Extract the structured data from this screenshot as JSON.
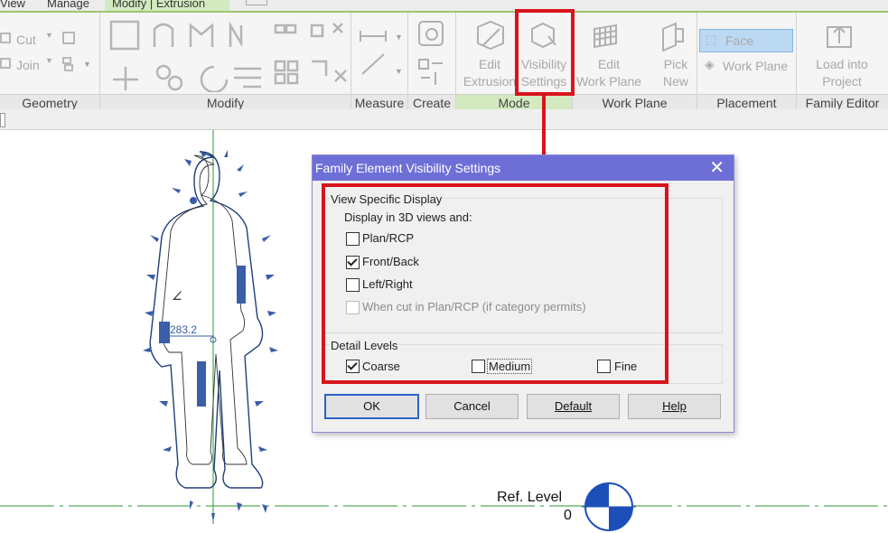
{
  "tabs": {
    "view": "View",
    "manage": "Manage",
    "modify_extrusion": "Modify | Extrusion"
  },
  "geometry_panel": {
    "cut": "Cut",
    "join": "Join",
    "label": "Geometry"
  },
  "modify_panel": {
    "label": "Modify"
  },
  "measure_panel": {
    "label": "Measure"
  },
  "create_panel": {
    "label": "Create"
  },
  "mode_panel": {
    "edit_extrusion": [
      "Edit",
      "Extrusion"
    ],
    "visibility_settings": [
      "Visibility",
      "Settings"
    ],
    "label": "Mode"
  },
  "work_plane_panel": {
    "edit_work_plane": [
      "Edit",
      "Work Plane"
    ],
    "pick_new": [
      "Pick",
      "New"
    ],
    "label": "Work Plane"
  },
  "placement_panel": {
    "face": "Face",
    "work_plane": "Work Plane",
    "label": "Placement"
  },
  "family_editor_panel": {
    "load_into_project": [
      "Load into",
      "Project"
    ],
    "label": "Family Editor"
  },
  "canvas": {
    "dimension": "283.2",
    "ref_level_label": "Ref. Level",
    "ref_level_value": "0"
  },
  "dialog": {
    "title": "Family Element Visibility Settings",
    "view_specific_display": "View Specific Display",
    "display_in_3d": "Display in 3D views and:",
    "options": [
      {
        "label": "Plan/RCP",
        "checked": false,
        "enabled": true
      },
      {
        "label": "Front/Back",
        "checked": true,
        "enabled": true
      },
      {
        "label": "Left/Right",
        "checked": false,
        "enabled": true
      },
      {
        "label": "When cut in Plan/RCP (if category permits)",
        "checked": false,
        "enabled": false
      }
    ],
    "detail_levels": "Detail Levels",
    "levels": [
      {
        "label": "Coarse",
        "checked": true
      },
      {
        "label": "Medium",
        "checked": false
      },
      {
        "label": "Fine",
        "checked": false
      }
    ],
    "buttons": {
      "ok": "OK",
      "cancel": "Cancel",
      "default": "Default",
      "help": "Help"
    }
  },
  "colors": {
    "highlight": "#d9141d",
    "title_bar": "#6e6fd6",
    "ribbon_accent": "#9ec66f",
    "level_marker": "#1d4fb8"
  }
}
